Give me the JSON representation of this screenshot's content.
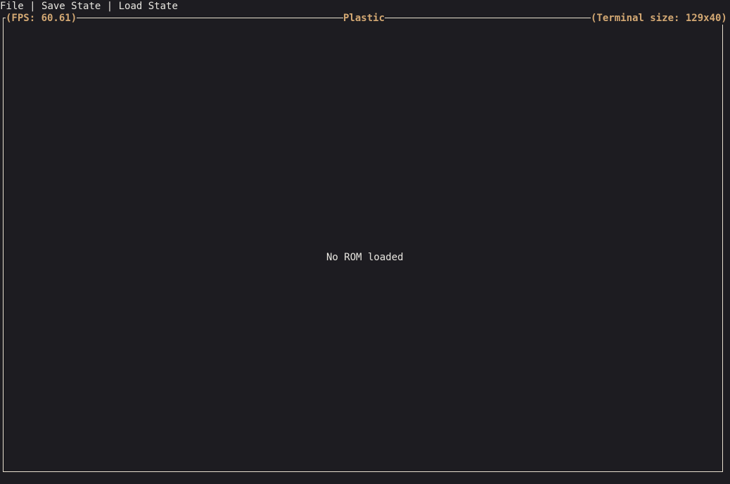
{
  "menu": {
    "file": "File",
    "save_state": "Save State",
    "load_state": "Load State",
    "separator": " | "
  },
  "frame": {
    "fps_label": "(FPS: 60.61)",
    "title": "Plastic",
    "terminal_size_label": "(Terminal size: 129x40)"
  },
  "main": {
    "message": "No ROM loaded"
  },
  "colors": {
    "background": "#1d1c21",
    "title_accent": "#d3a873",
    "border": "#e8e0cf",
    "text": "#e8e6e0"
  }
}
